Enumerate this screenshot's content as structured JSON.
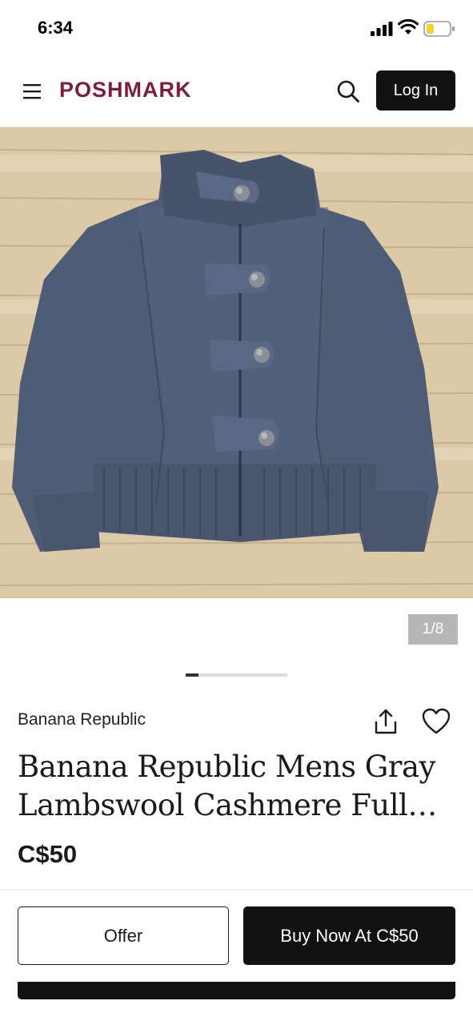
{
  "status_bar": {
    "time": "6:34"
  },
  "header": {
    "logo": "POSHMARK",
    "login_label": "Log In"
  },
  "gallery": {
    "counter": "1/8",
    "current": 1,
    "total": 8
  },
  "listing": {
    "brand": "Banana Republic",
    "title": "Banana Republic Mens Gray Lambswool Cashmere Full…",
    "price": "C$50"
  },
  "actions": {
    "offer_label": "Offer",
    "buy_label": "Buy Now At C$50"
  },
  "colors": {
    "brand": "#7b1e3a",
    "primary": "#121212",
    "counter_bg": "#b7b7b7"
  },
  "icons": [
    "menu-icon",
    "search-icon",
    "share-icon",
    "heart-icon",
    "signal-icon",
    "wifi-icon",
    "battery-icon"
  ]
}
